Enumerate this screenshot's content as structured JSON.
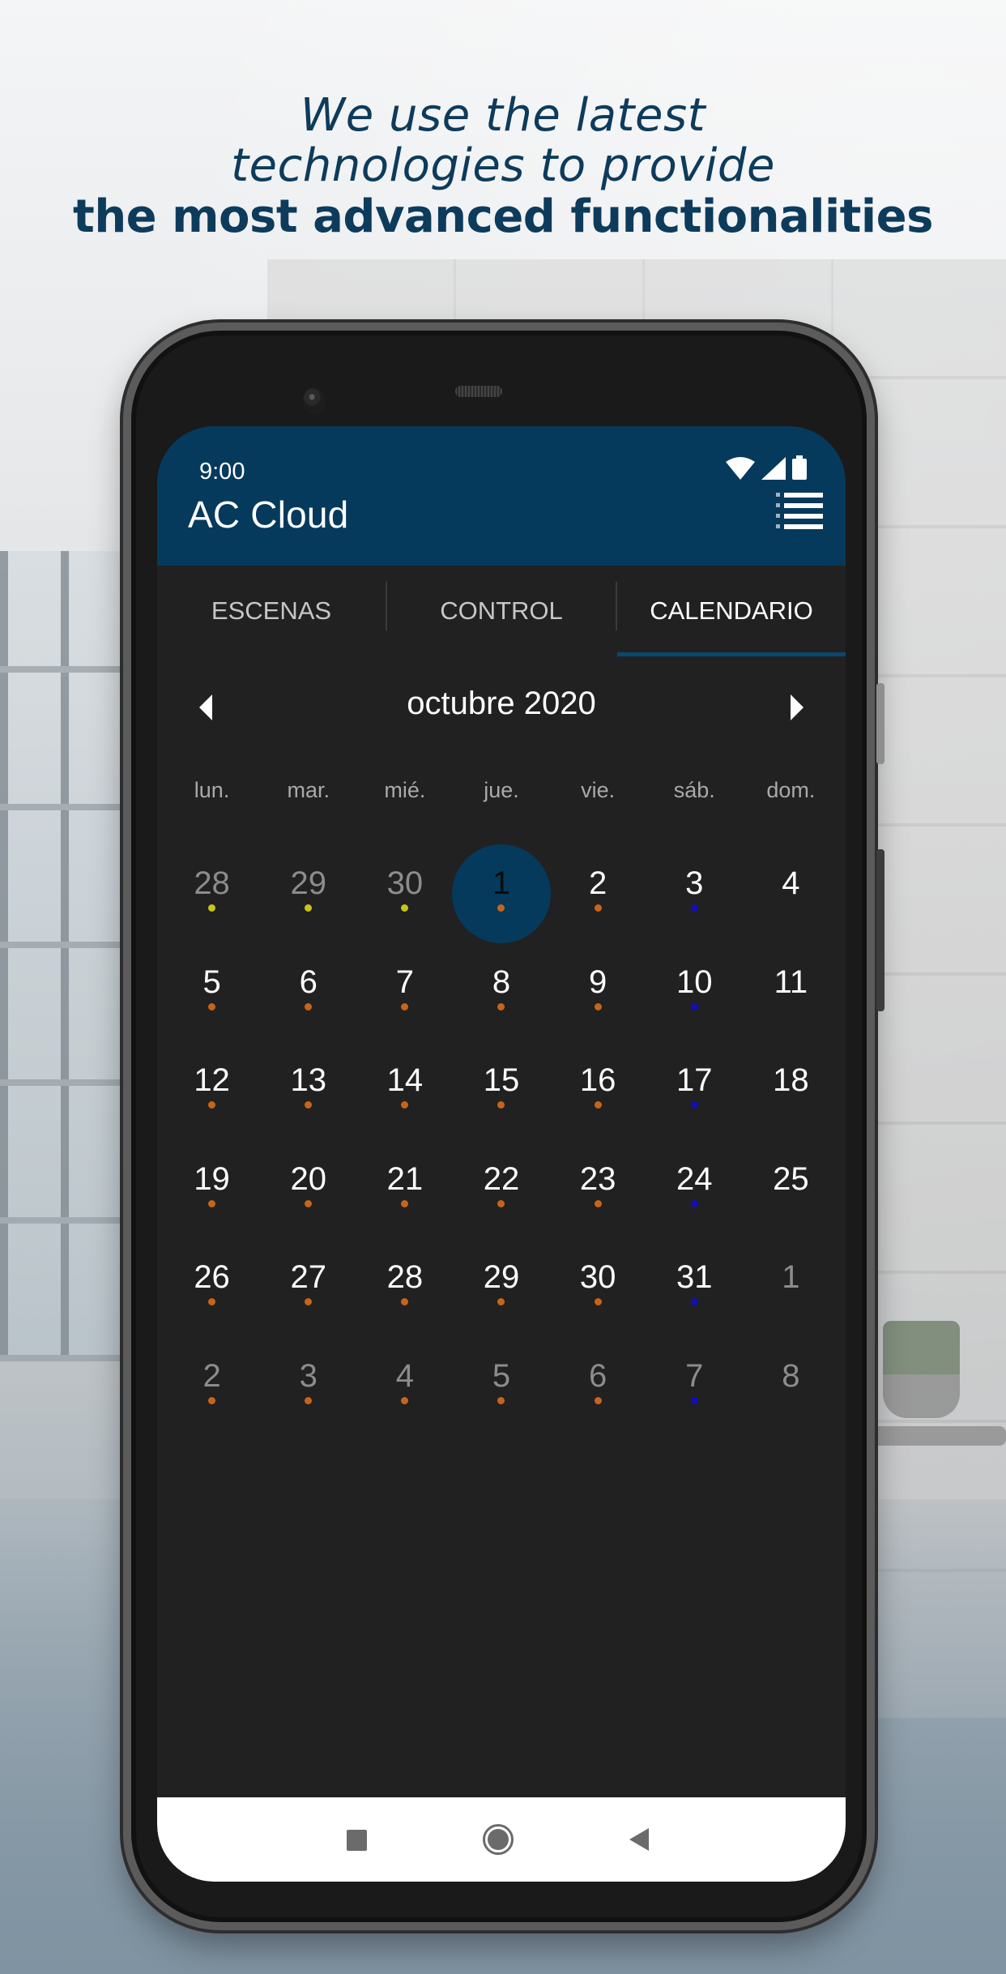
{
  "headline": {
    "line1": "We use the latest",
    "line2": "technologies to provide",
    "line3": "the most advanced functionalities"
  },
  "status_bar": {
    "time": "9:00",
    "icons": [
      "wifi-icon",
      "signal-icon",
      "battery-icon"
    ]
  },
  "app": {
    "title": "AC Cloud",
    "menu_icon": "list-icon",
    "accent_color": "#053a5c"
  },
  "tabs": [
    {
      "label": "ESCENAS",
      "active": false
    },
    {
      "label": "CONTROL",
      "active": false
    },
    {
      "label": "CALENDARIO",
      "active": true
    }
  ],
  "calendar": {
    "month_label": "octubre 2020",
    "prev_icon": "triangle-left-icon",
    "next_icon": "triangle-right-icon",
    "weekdays": [
      "lun.",
      "mar.",
      "mié.",
      "jue.",
      "vie.",
      "sáb.",
      "dom."
    ],
    "dot_colors": {
      "yellow": "#c8c41a",
      "orange": "#c8641a",
      "blue": "#1010b4"
    },
    "selected_day": "1",
    "weeks": [
      [
        {
          "n": "28",
          "outside": true,
          "dot": "yellow"
        },
        {
          "n": "29",
          "outside": true,
          "dot": "yellow"
        },
        {
          "n": "30",
          "outside": true,
          "dot": "yellow"
        },
        {
          "n": "1",
          "outside": false,
          "dot": "orange",
          "selected": true
        },
        {
          "n": "2",
          "outside": false,
          "dot": "orange"
        },
        {
          "n": "3",
          "outside": false,
          "dot": "blue"
        },
        {
          "n": "4",
          "outside": false,
          "dot": null
        }
      ],
      [
        {
          "n": "5",
          "outside": false,
          "dot": "orange"
        },
        {
          "n": "6",
          "outside": false,
          "dot": "orange"
        },
        {
          "n": "7",
          "outside": false,
          "dot": "orange"
        },
        {
          "n": "8",
          "outside": false,
          "dot": "orange"
        },
        {
          "n": "9",
          "outside": false,
          "dot": "orange"
        },
        {
          "n": "10",
          "outside": false,
          "dot": "blue"
        },
        {
          "n": "11",
          "outside": false,
          "dot": null
        }
      ],
      [
        {
          "n": "12",
          "outside": false,
          "dot": "orange"
        },
        {
          "n": "13",
          "outside": false,
          "dot": "orange"
        },
        {
          "n": "14",
          "outside": false,
          "dot": "orange"
        },
        {
          "n": "15",
          "outside": false,
          "dot": "orange"
        },
        {
          "n": "16",
          "outside": false,
          "dot": "orange"
        },
        {
          "n": "17",
          "outside": false,
          "dot": "blue"
        },
        {
          "n": "18",
          "outside": false,
          "dot": null
        }
      ],
      [
        {
          "n": "19",
          "outside": false,
          "dot": "orange"
        },
        {
          "n": "20",
          "outside": false,
          "dot": "orange"
        },
        {
          "n": "21",
          "outside": false,
          "dot": "orange"
        },
        {
          "n": "22",
          "outside": false,
          "dot": "orange"
        },
        {
          "n": "23",
          "outside": false,
          "dot": "orange"
        },
        {
          "n": "24",
          "outside": false,
          "dot": "blue"
        },
        {
          "n": "25",
          "outside": false,
          "dot": null
        }
      ],
      [
        {
          "n": "26",
          "outside": false,
          "dot": "orange"
        },
        {
          "n": "27",
          "outside": false,
          "dot": "orange"
        },
        {
          "n": "28",
          "outside": false,
          "dot": "orange"
        },
        {
          "n": "29",
          "outside": false,
          "dot": "orange"
        },
        {
          "n": "30",
          "outside": false,
          "dot": "orange"
        },
        {
          "n": "31",
          "outside": false,
          "dot": "blue"
        },
        {
          "n": "1",
          "outside": true,
          "dot": null
        }
      ],
      [
        {
          "n": "2",
          "outside": true,
          "dot": "orange"
        },
        {
          "n": "3",
          "outside": true,
          "dot": "orange"
        },
        {
          "n": "4",
          "outside": true,
          "dot": "orange"
        },
        {
          "n": "5",
          "outside": true,
          "dot": "orange"
        },
        {
          "n": "6",
          "outside": true,
          "dot": "orange"
        },
        {
          "n": "7",
          "outside": true,
          "dot": "blue"
        },
        {
          "n": "8",
          "outside": true,
          "dot": null
        }
      ]
    ]
  },
  "system_nav": {
    "buttons": [
      "recents-icon",
      "home-icon",
      "back-icon"
    ]
  }
}
